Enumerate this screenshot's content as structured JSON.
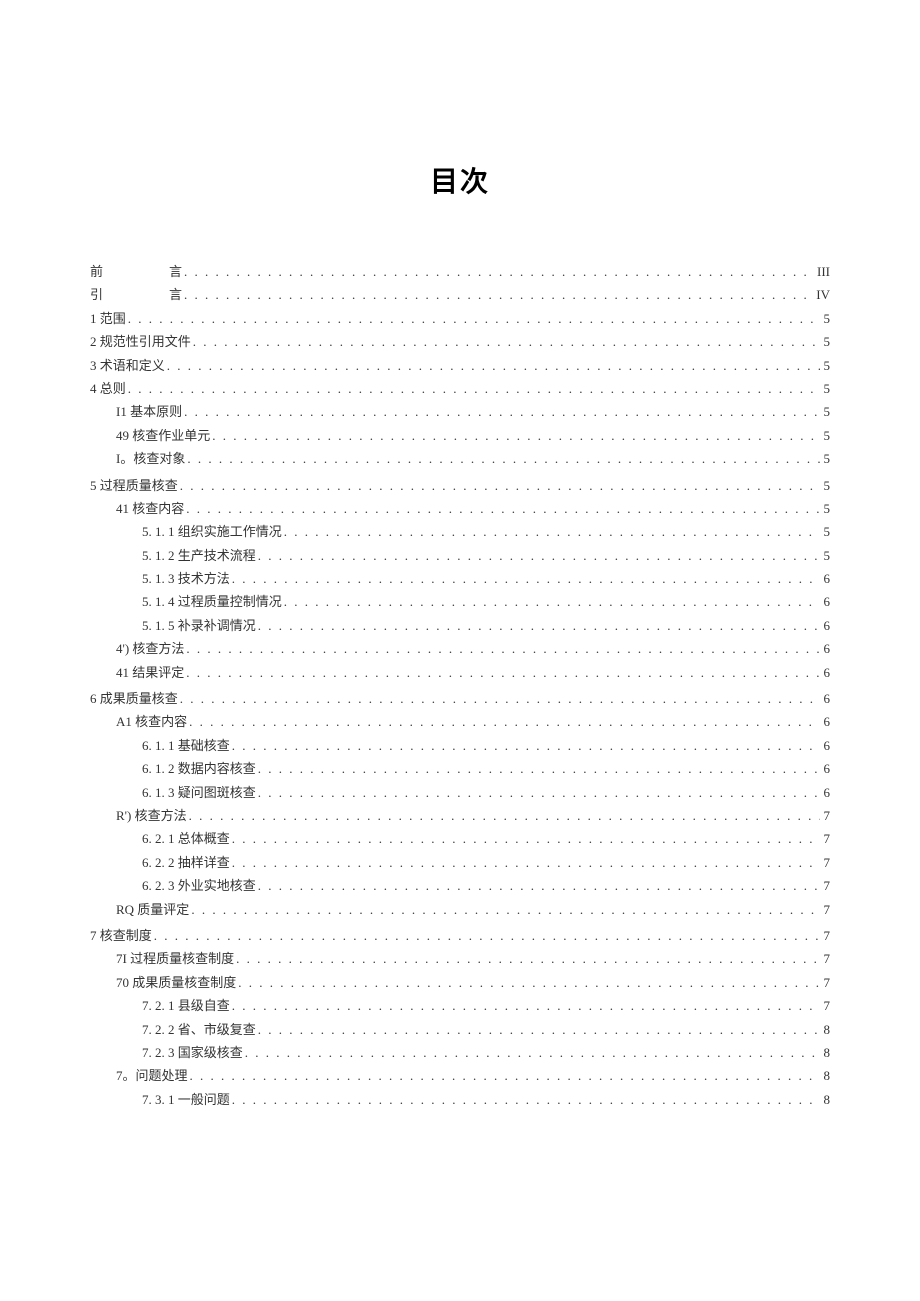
{
  "title": "目次",
  "toc": [
    {
      "label": "前",
      "trail": "言",
      "page": "III",
      "indent": 0,
      "spaced": true,
      "gap": false
    },
    {
      "label": "引",
      "trail": "言",
      "page": "IV",
      "indent": 0,
      "spaced": true,
      "gap": false
    },
    {
      "label": "1 范围",
      "page": "5",
      "indent": 0,
      "gap": false
    },
    {
      "label": "2 规范性引用文件",
      "page": "5",
      "indent": 0,
      "gap": false
    },
    {
      "label": "3 术语和定义",
      "page": "5",
      "indent": 0,
      "gap": false
    },
    {
      "label": "4 总则",
      "page": "5",
      "indent": 0,
      "gap": false
    },
    {
      "label": "I1 基本原则",
      "page": "5",
      "indent": 1,
      "gap": false
    },
    {
      "label": "49 核查作业单元",
      "page": "5",
      "indent": 1,
      "gap": false
    },
    {
      "label": "I。核查对象",
      "page": "5",
      "indent": 1,
      "gap": false
    },
    {
      "label": "5 过程质量核查",
      "page": "5",
      "indent": 0,
      "gap": true
    },
    {
      "label": "41 核查内容",
      "page": "5",
      "indent": 1,
      "gap": false
    },
    {
      "label": "5. 1. 1 组织实施工作情况",
      "page": "5",
      "indent": 2,
      "gap": false
    },
    {
      "label": "5. 1. 2 生产技术流程",
      "page": "5",
      "indent": 2,
      "gap": false
    },
    {
      "label": "5. 1. 3 技术方法",
      "page": "6",
      "indent": 2,
      "gap": false
    },
    {
      "label": "5. 1. 4 过程质量控制情况",
      "page": "6",
      "indent": 2,
      "gap": false
    },
    {
      "label": "5. 1. 5 补录补调情况",
      "page": "6",
      "indent": 2,
      "gap": false
    },
    {
      "label": "4') 核查方法",
      "page": "6",
      "indent": 1,
      "gap": false
    },
    {
      "label": "41 结果评定",
      "page": "6",
      "indent": 1,
      "gap": false
    },
    {
      "label": "6 成果质量核查",
      "page": "6",
      "indent": 0,
      "gap": true
    },
    {
      "label": "A1 核查内容",
      "page": "6",
      "indent": 1,
      "gap": false
    },
    {
      "label": "6. 1. 1 基础核查",
      "page": "6",
      "indent": 2,
      "gap": false
    },
    {
      "label": "6. 1. 2 数据内容核查",
      "page": "6",
      "indent": 2,
      "gap": false
    },
    {
      "label": "6. 1. 3 疑问图斑核查",
      "page": "6",
      "indent": 2,
      "gap": false
    },
    {
      "label": "R') 核查方法",
      "page": "7",
      "indent": 1,
      "gap": false
    },
    {
      "label": "6. 2. 1 总体概查",
      "page": "7",
      "indent": 2,
      "gap": false
    },
    {
      "label": "6. 2. 2 抽样详查",
      "page": "7",
      "indent": 2,
      "gap": false
    },
    {
      "label": "6. 2. 3 外业实地核查",
      "page": "7",
      "indent": 2,
      "gap": false
    },
    {
      "label": "RQ 质量评定",
      "page": "7",
      "indent": 1,
      "gap": false
    },
    {
      "label": "7 核查制度",
      "page": "7",
      "indent": 0,
      "gap": true
    },
    {
      "label": "7I 过程质量核查制度",
      "page": "7",
      "indent": 1,
      "gap": false
    },
    {
      "label": "70 成果质量核查制度",
      "page": "7",
      "indent": 1,
      "gap": false
    },
    {
      "label": "7. 2. 1 县级自查",
      "page": "7",
      "indent": 2,
      "gap": false
    },
    {
      "label": "7. 2. 2 省、市级复查",
      "page": "8",
      "indent": 2,
      "gap": false
    },
    {
      "label": "7. 2. 3 国家级核查",
      "page": "8",
      "indent": 2,
      "gap": false
    },
    {
      "label": "7。问题处理",
      "page": "8",
      "indent": 1,
      "gap": false
    },
    {
      "label": "7. 3. 1 一般问题",
      "page": "8",
      "indent": 2,
      "gap": false
    }
  ]
}
